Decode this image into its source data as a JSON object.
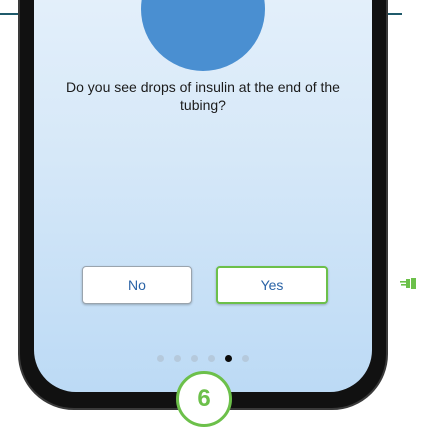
{
  "question": "Do you see drops of insulin at the end of the tubing?",
  "buttons": {
    "no_label": "No",
    "yes_label": "Yes"
  },
  "pagination": {
    "total": 6,
    "active_index": 5
  },
  "step": {
    "number": "6"
  },
  "colors": {
    "accent_green": "#6cc04a",
    "button_text_blue": "#2a63a6",
    "illustration_blue": "#4a8fd1",
    "top_rule": "#1f5a6b"
  },
  "icons": {
    "pointer": "hand-pointer-icon"
  }
}
